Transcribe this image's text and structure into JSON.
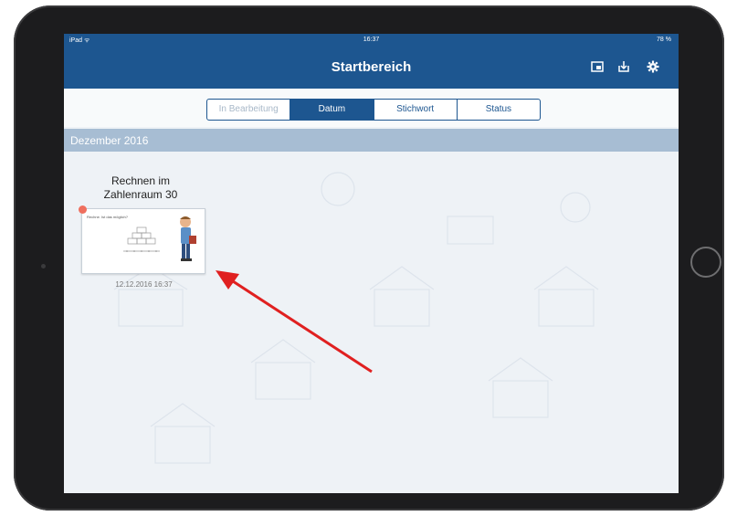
{
  "status_bar": {
    "left": "iPad ᯤ",
    "time": "16:37",
    "right": "78 %"
  },
  "navbar": {
    "title": "Startbereich"
  },
  "icons": {
    "export": "export-icon",
    "download": "download-icon",
    "settings": "gear-icon"
  },
  "segments": [
    {
      "label": "In Bearbeitung",
      "state": "disabled"
    },
    {
      "label": "Datum",
      "state": "active"
    },
    {
      "label": "Stichwort",
      "state": "normal"
    },
    {
      "label": "Status",
      "state": "normal"
    }
  ],
  "section": {
    "header": "Dezember 2016"
  },
  "document": {
    "title_line1": "Rechnen im",
    "title_line2": "Zahlenraum 30",
    "thumb_question": "Rechne. Ist das möglich?",
    "timestamp": "12.12.2016 16:37"
  },
  "colors": {
    "nav": "#1d5690",
    "section": "#a7bdd3",
    "badge": "#ef6f5e",
    "arrow": "#e02020"
  }
}
